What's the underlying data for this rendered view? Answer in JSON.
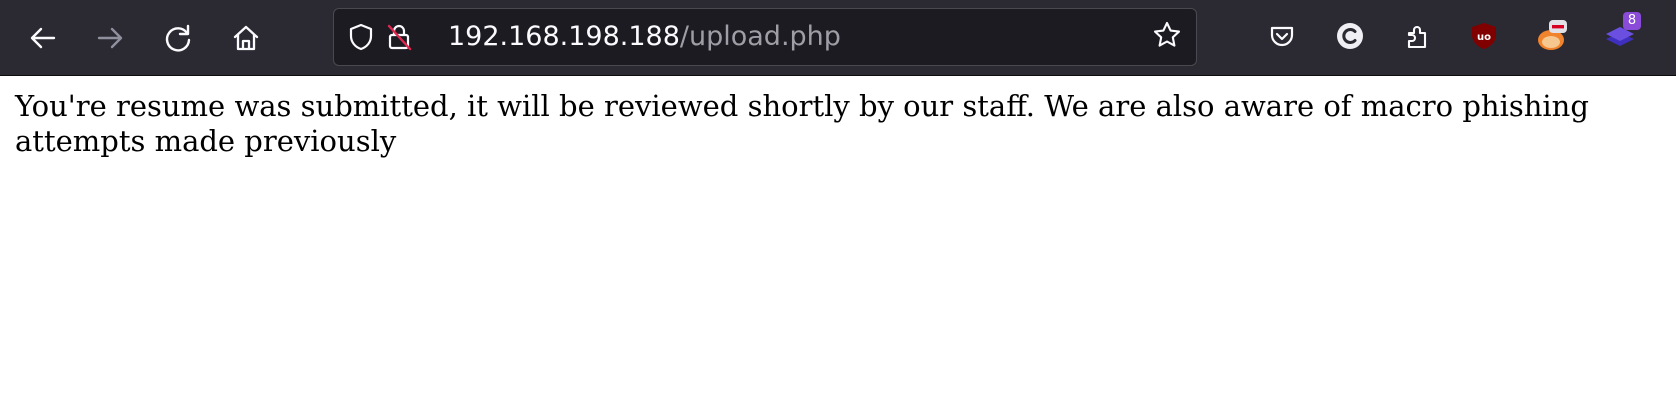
{
  "toolbar": {
    "back_icon": "arrow-left-icon",
    "forward_icon": "arrow-right-icon",
    "reload_icon": "reload-icon",
    "home_icon": "home-icon",
    "colors": {
      "background": "#2b2a33",
      "icon": "#fbfbfe",
      "disabled_icon": "#8f8f9d"
    }
  },
  "urlbar": {
    "host": "192.168.198.188",
    "path": "/upload.php",
    "tracking_protection_icon": "shield-icon",
    "insecure_lock_icon": "insecure-lock-icon",
    "bookmark_icon": "star-icon"
  },
  "extensions": {
    "pocket_icon": "pocket-icon",
    "c_icon": "c-extension-icon",
    "extensions_icon": "puzzle-icon",
    "ublock_icon": "ublock-origin-icon",
    "foxy_icon": "foxyproxy-icon",
    "layers_icon": "layers-icon",
    "layers_badge": "8"
  },
  "page": {
    "message": "You're resume was submitted, it will be reviewed shortly by our staff. We are also aware of macro phishing attempts made previously"
  }
}
